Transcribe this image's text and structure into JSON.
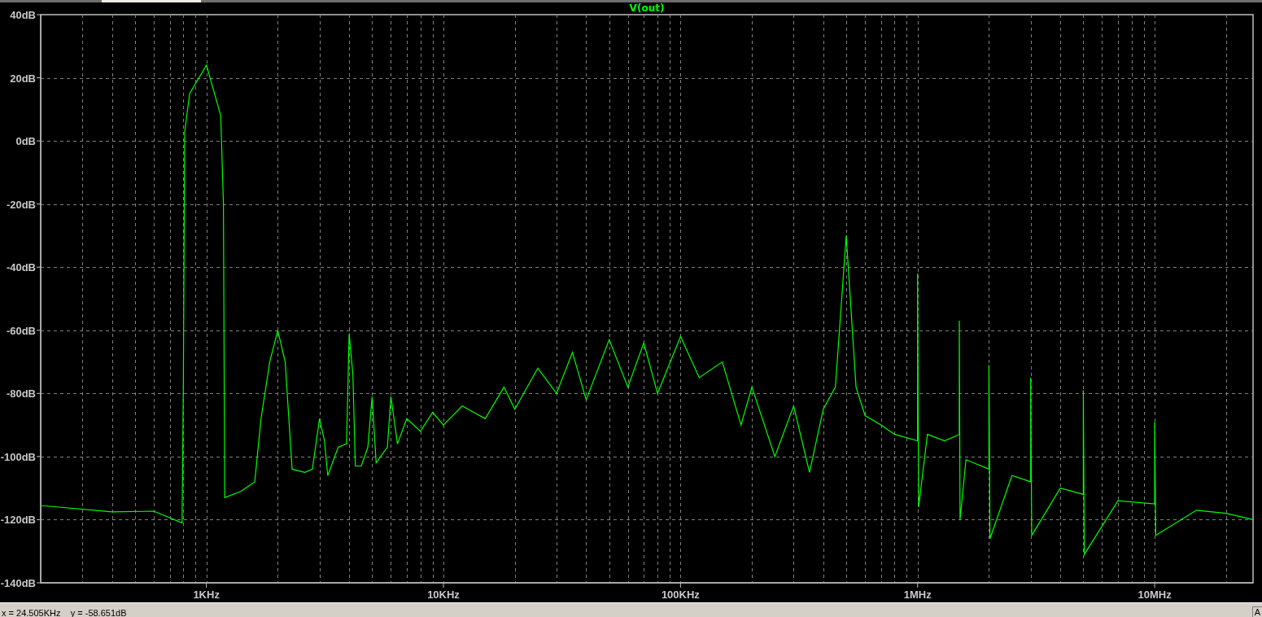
{
  "plot": {
    "trace_label": "V(out)",
    "y_axis_labels": [
      "40dB",
      "20dB",
      "0dB",
      "-20dB",
      "-40dB",
      "-60dB",
      "-80dB",
      "-100dB",
      "-120dB",
      "-140dB"
    ],
    "x_axis_labels": [
      "1KHz",
      "10KHz",
      "100KHz",
      "1MHz",
      "10MHz"
    ]
  },
  "status_bar": {
    "readout": "x = 24.505KHz    y = -58.651dB",
    "box": "A"
  }
}
